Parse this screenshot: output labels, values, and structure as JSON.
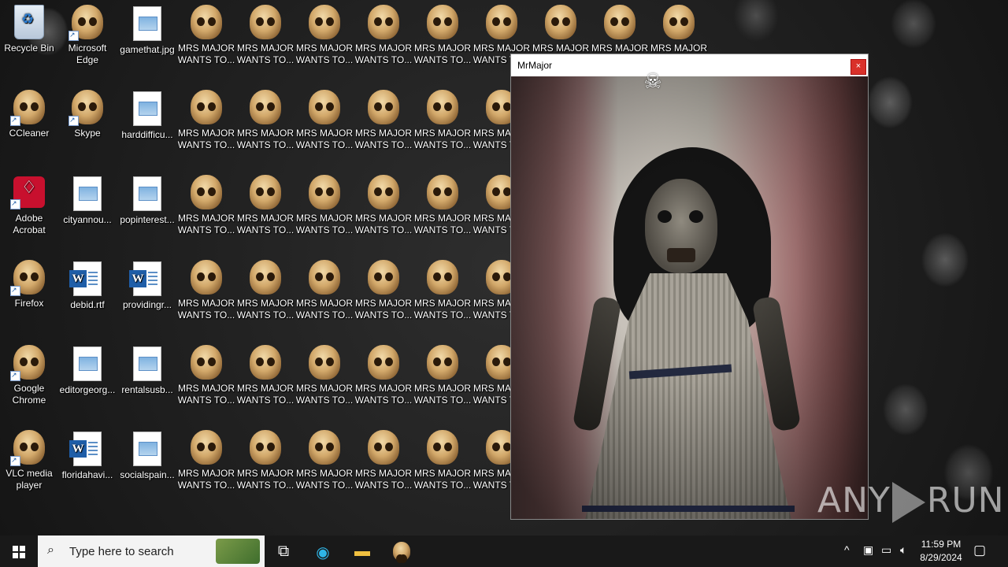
{
  "desktop": {
    "icons": [
      {
        "label": "Recycle Bin",
        "kind": "recycle"
      },
      {
        "label": "Microsoft Edge",
        "kind": "skull"
      },
      {
        "label": "gamethat.jpg",
        "kind": "doc"
      },
      {
        "label": "CCleaner",
        "kind": "skull"
      },
      {
        "label": "Skype",
        "kind": "skull"
      },
      {
        "label": "harddifficu...",
        "kind": "doc"
      },
      {
        "label": "Adobe Acrobat",
        "kind": "acrobat"
      },
      {
        "label": "cityannou...",
        "kind": "doc"
      },
      {
        "label": "popinterest...",
        "kind": "doc"
      },
      {
        "label": "Firefox",
        "kind": "skull"
      },
      {
        "label": "debid.rtf",
        "kind": "word"
      },
      {
        "label": "providingr...",
        "kind": "word"
      },
      {
        "label": "Google Chrome",
        "kind": "skull"
      },
      {
        "label": "editorgeorg...",
        "kind": "doc"
      },
      {
        "label": "rentalsusb...",
        "kind": "doc"
      },
      {
        "label": "VLC media player",
        "kind": "skull"
      },
      {
        "label": "floridahavi...",
        "kind": "word"
      },
      {
        "label": "socialspain...",
        "kind": "doc"
      }
    ],
    "malware_icon_label": "MRS MAJOR WANTS TO...",
    "malware_label_line1": "MRS MAJOR",
    "malware_label_line2": "WANTS TO..."
  },
  "window": {
    "title": "MrMajor",
    "close_label": "×"
  },
  "watermark": {
    "text_left": "ANY",
    "text_right": "RUN"
  },
  "taskbar": {
    "search_placeholder": "Type here to search",
    "time": "11:59 PM",
    "date": "8/29/2024"
  },
  "colors": {
    "taskbar": "#191919",
    "close_button": "#d9312a"
  },
  "icons": [
    "windows-start-icon",
    "search-icon",
    "task-view-icon",
    "edge-icon",
    "file-explorer-icon",
    "skull-icon",
    "chevron-up-icon",
    "network-icon",
    "volume-icon",
    "notification-icon"
  ]
}
